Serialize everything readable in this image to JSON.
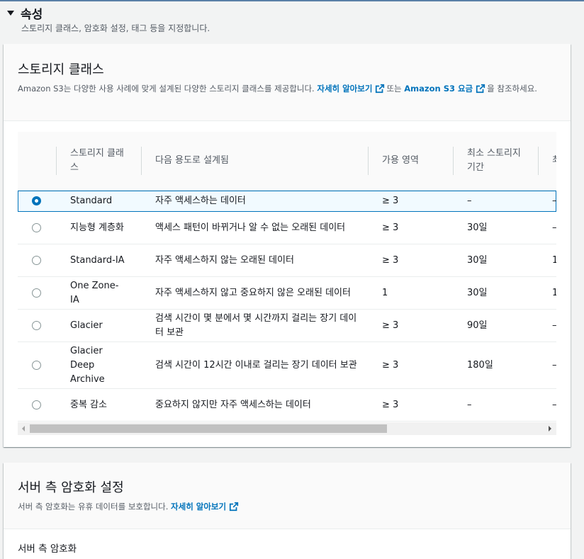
{
  "section": {
    "title": "속성",
    "description": "스토리지 클래스, 암호화 설정, 태그 등을 지정합니다."
  },
  "storage_card": {
    "title": "스토리지 클래스",
    "desc_part1": "Amazon S3는 다양한 사용 사례에 맞게 설계된 다양한 스토리지 클래스를 제공합니다.",
    "learn_more": "자세히 알아보기",
    "desc_part2": "또는",
    "pricing_link": "Amazon S3 요금",
    "desc_part3": "을 참조하세요.",
    "columns": [
      "스토리지 클래스",
      "다음 용도로 설계됨",
      "가용 영역",
      "최소 스토리지 기간",
      "최"
    ],
    "rows": [
      {
        "name": "Standard",
        "use": "자주 액세스하는 데이터",
        "az": "≥ 3",
        "min": "–",
        "extra": "–",
        "selected": true
      },
      {
        "name": "지능형 계층화",
        "use": "액세스 패턴이 바뀌거나 알 수 없는 오래된 데이터",
        "az": "≥ 3",
        "min": "30일",
        "extra": "–",
        "selected": false
      },
      {
        "name": "Standard-IA",
        "use": "자주 액세스하지 않는 오래된 데이터",
        "az": "≥ 3",
        "min": "30일",
        "extra": "1",
        "selected": false
      },
      {
        "name": "One Zone-IA",
        "use": "자주 액세스하지 않고 중요하지 않은 오래된 데이터",
        "az": "1",
        "min": "30일",
        "extra": "1",
        "selected": false
      },
      {
        "name": "Glacier",
        "use": "검색 시간이 몇 분에서 몇 시간까지 걸리는 장기 데이터 보관",
        "az": "≥ 3",
        "min": "90일",
        "extra": "–",
        "selected": false
      },
      {
        "name": "Glacier Deep Archive",
        "use": "검색 시간이 12시간 이내로 걸리는 장기 데이터 보관",
        "az": "≥ 3",
        "min": "180일",
        "extra": "–",
        "selected": false
      },
      {
        "name": "중복 감소",
        "use": "중요하지 않지만 자주 액세스하는 데이터",
        "az": "≥ 3",
        "min": "–",
        "extra": "–",
        "selected": false
      }
    ]
  },
  "encryption_card": {
    "title": "서버 측 암호화 설정",
    "desc": "서버 측 암호화는 유휴 데이터를 보호합니다.",
    "learn_more": "자세히 알아보기",
    "field_label": "서버 측 암호화"
  },
  "icons": {
    "caret": "caret-down-icon",
    "external": "external-link-icon",
    "scroll_left": "scroll-left-icon",
    "scroll_right": "scroll-right-icon"
  },
  "colors": {
    "link": "#0073bb",
    "selected_row_bg": "#f1faff",
    "selected_border": "#0073bb"
  }
}
